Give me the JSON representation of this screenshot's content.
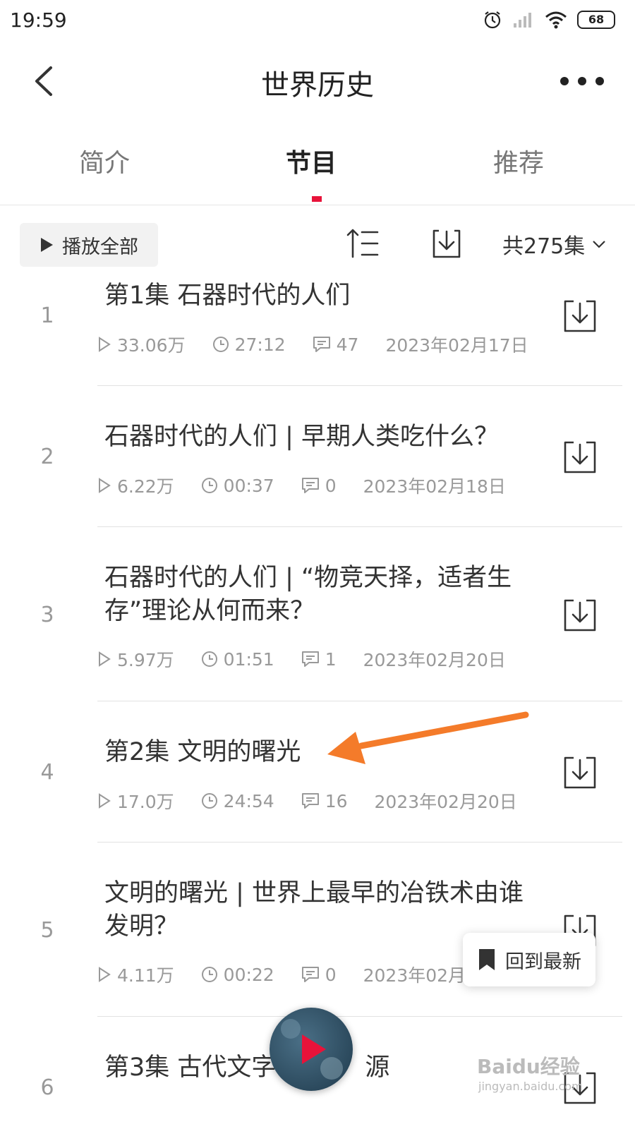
{
  "status_bar": {
    "time": "19:59",
    "battery": "68"
  },
  "header": {
    "title": "世界历史"
  },
  "tabs": [
    {
      "label": "简介",
      "active": false
    },
    {
      "label": "节目",
      "active": true
    },
    {
      "label": "推荐",
      "active": false
    }
  ],
  "toolbar": {
    "play_all_label": "播放全部",
    "episode_count": "共275集"
  },
  "episodes": [
    {
      "num": "1",
      "title": "第1集 石器时代的人们",
      "plays": "33.06万",
      "duration": "27:12",
      "comments": "47",
      "date": "2023年02月17日"
    },
    {
      "num": "2",
      "title": "石器时代的人们 | 早期人类吃什么？",
      "plays": "6.22万",
      "duration": "00:37",
      "comments": "0",
      "date": "2023年02月18日"
    },
    {
      "num": "3",
      "title": "石器时代的人们 | “物竞天择，适者生存”理论从何而来？",
      "plays": "5.97万",
      "duration": "01:51",
      "comments": "1",
      "date": "2023年02月20日"
    },
    {
      "num": "4",
      "title": "第2集 文明的曙光",
      "plays": "17.0万",
      "duration": "24:54",
      "comments": "16",
      "date": "2023年02月20日"
    },
    {
      "num": "5",
      "title": "文明的曙光 | 世界上最早的冶铁术由谁发明？",
      "plays": "4.11万",
      "duration": "00:22",
      "comments": "0",
      "date": "2023年02月2"
    },
    {
      "num": "6",
      "title": "第3集 古代文字",
      "title_tail": "源"
    }
  ],
  "floating": {
    "back_to_latest": "回到最新"
  },
  "watermark": {
    "brand": "Baidu经验",
    "url": "jingyan.baidu.com"
  },
  "colors": {
    "accent": "#e8133a",
    "annotation_arrow": "#f47b2a"
  }
}
